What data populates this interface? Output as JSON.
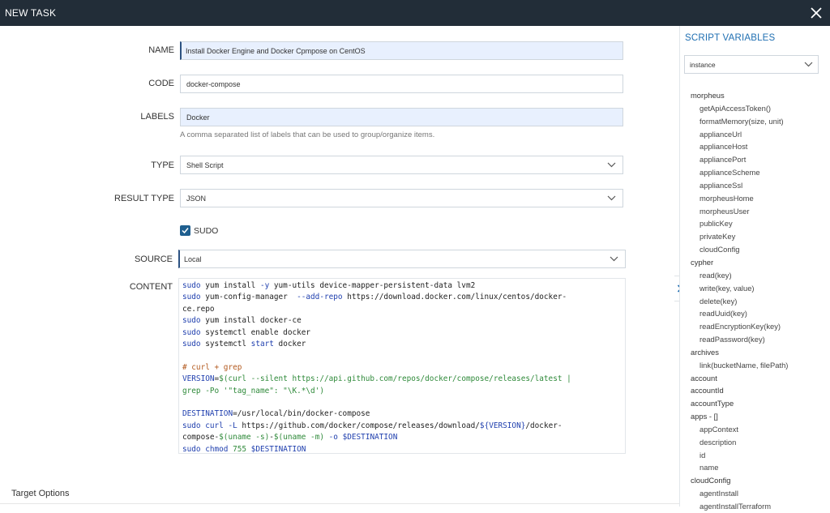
{
  "dialog": {
    "title": "NEW TASK",
    "close_icon": "close-icon"
  },
  "form": {
    "name": {
      "label": "NAME",
      "value": "Install Docker Engine and Docker Cpmpose on CentOS"
    },
    "code": {
      "label": "CODE",
      "value": "docker-compose"
    },
    "labels": {
      "label": "LABELS",
      "value": "Docker",
      "helper": "A comma separated list of labels that can be used to group/organize items."
    },
    "type": {
      "label": "TYPE",
      "value": "Shell Script"
    },
    "result_type": {
      "label": "RESULT TYPE",
      "value": "JSON"
    },
    "sudo": {
      "label": "SUDO",
      "checked": true
    },
    "source": {
      "label": "SOURCE",
      "value": "Local"
    },
    "content": {
      "label": "CONTENT",
      "lines": [
        "sudo yum install -y yum-utils device-mapper-persistent-data lvm2",
        "sudo yum-config-manager  --add-repo https://download.docker.com/linux/centos/docker-",
        "ce.repo",
        "sudo yum install docker-ce",
        "sudo systemctl enable docker",
        "sudo systemctl start docker",
        "",
        "# curl + grep",
        "VERSION=$(curl --silent https://api.github.com/repos/docker/compose/releases/latest |",
        "grep -Po '\"tag_name\": \"\\K.*\\d')",
        "",
        "DESTINATION=/usr/local/bin/docker-compose",
        "sudo curl -L https://github.com/docker/compose/releases/download/${VERSION}/docker-",
        "compose-$(uname -s)-$(uname -m) -o $DESTINATION",
        "sudo chmod 755 $DESTINATION"
      ]
    },
    "target_options": "Target Options"
  },
  "sidebar": {
    "title": "SCRIPT VARIABLES",
    "select_value": "instance",
    "items": [
      {
        "text": "morpheus",
        "group": true
      },
      {
        "text": "getApiAccessToken()",
        "group": false
      },
      {
        "text": "formatMemory(size, unit)",
        "group": false
      },
      {
        "text": "applianceUrl",
        "group": false
      },
      {
        "text": "applianceHost",
        "group": false
      },
      {
        "text": "appliancePort",
        "group": false
      },
      {
        "text": "applianceScheme",
        "group": false
      },
      {
        "text": "applianceSsl",
        "group": false
      },
      {
        "text": "morpheusHome",
        "group": false
      },
      {
        "text": "morpheusUser",
        "group": false
      },
      {
        "text": "publicKey",
        "group": false
      },
      {
        "text": "privateKey",
        "group": false
      },
      {
        "text": "cloudConfig",
        "group": false
      },
      {
        "text": "cypher",
        "group": true
      },
      {
        "text": "read(key)",
        "group": false
      },
      {
        "text": "write(key, value)",
        "group": false
      },
      {
        "text": "delete(key)",
        "group": false
      },
      {
        "text": "readUuid(key)",
        "group": false
      },
      {
        "text": "readEncryptionKey(key)",
        "group": false
      },
      {
        "text": "readPassword(key)",
        "group": false
      },
      {
        "text": "archives",
        "group": true
      },
      {
        "text": "link(bucketName, filePath)",
        "group": false
      },
      {
        "text": "account",
        "group": true
      },
      {
        "text": "accountId",
        "group": true
      },
      {
        "text": "accountType",
        "group": true
      },
      {
        "text": "apps - []",
        "group": true
      },
      {
        "text": "appContext",
        "group": false
      },
      {
        "text": "description",
        "group": false
      },
      {
        "text": "id",
        "group": false
      },
      {
        "text": "name",
        "group": false
      },
      {
        "text": "cloudConfig",
        "group": true
      },
      {
        "text": "agentInstall",
        "group": false
      },
      {
        "text": "agentInstallTerraform",
        "group": false
      }
    ]
  },
  "colors": {
    "topbar": "#222d38",
    "accent": "#1f6fb2",
    "checkbox": "#1f5f8f",
    "field_filled": "#e8f0fe"
  }
}
